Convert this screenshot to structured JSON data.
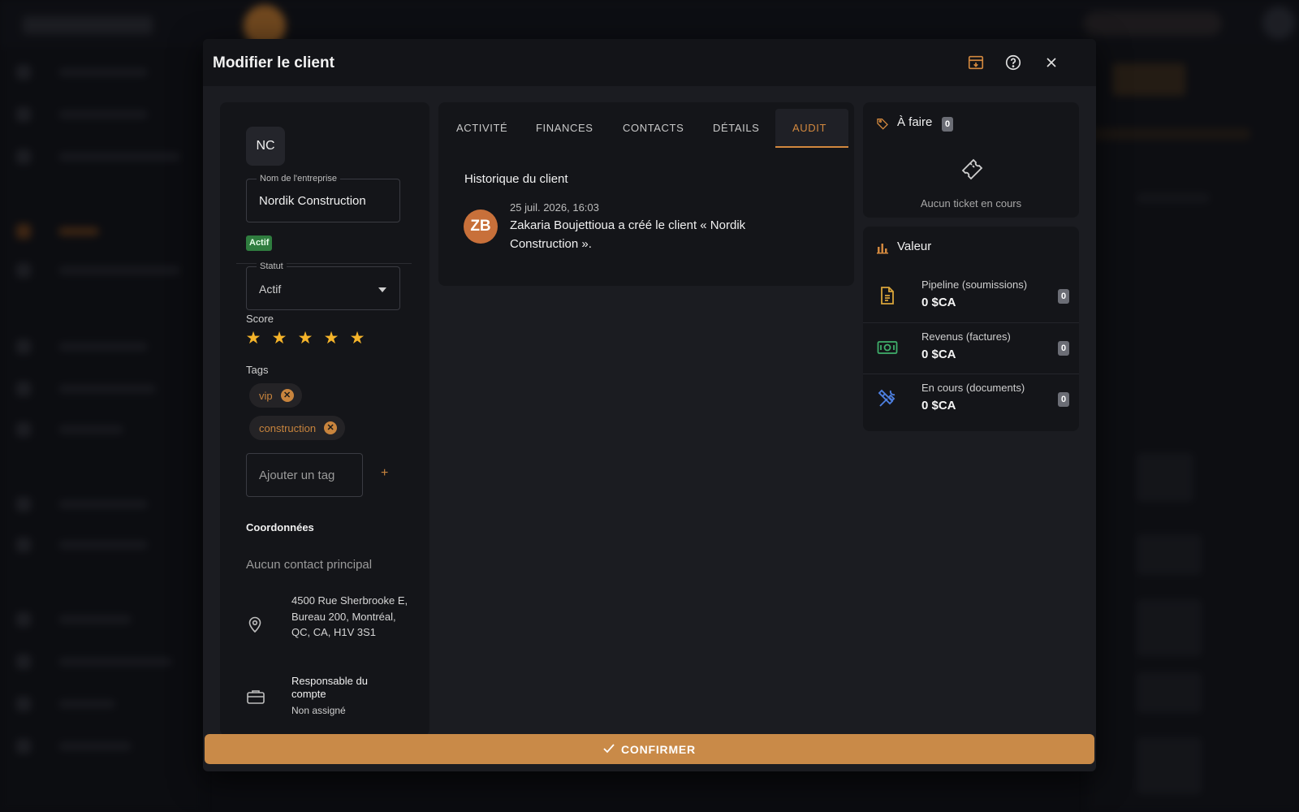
{
  "modal": {
    "title": "Modifier le client",
    "confirm_label": "CONFIRMER"
  },
  "client": {
    "initials": "NC",
    "company_label": "Nom de l'entreprise",
    "company_name": "Nordik Construction",
    "status_badge": "Actif",
    "status_label": "Statut",
    "status_value": "Actif",
    "score_label": "Score",
    "score": 5,
    "tags_label": "Tags",
    "tags": [
      "vip",
      "construction"
    ],
    "add_tag_placeholder": "Ajouter un tag",
    "add_tag_symbol": "+",
    "coords_title": "Coordonnées",
    "no_contact": "Aucun contact principal",
    "address": "4500 Rue Sherbrooke E, Bureau 200, Montréal, QC, CA, H1V 3S1",
    "account_manager_label": "Responsable du compte",
    "account_manager_value": "Non assigné"
  },
  "tabs": [
    {
      "label": "ACTIVITÉ",
      "active": false
    },
    {
      "label": "FINANCES",
      "active": false
    },
    {
      "label": "CONTACTS",
      "active": false
    },
    {
      "label": "DÉTAILS",
      "active": false
    },
    {
      "label": "AUDIT",
      "active": true
    }
  ],
  "history": {
    "title": "Historique du client",
    "entries": [
      {
        "avatar": "ZB",
        "date": "25 juil. 2026, 16:03",
        "text": "Zakaria Boujettioua a créé le client « Nordik Construction »."
      }
    ]
  },
  "todo": {
    "title": "À faire",
    "count": "0",
    "empty_text": "Aucun ticket en cours"
  },
  "value": {
    "title": "Valeur",
    "rows": [
      {
        "label": "Pipeline (soumissions)",
        "amount": "0 $CA",
        "count": "0",
        "icon": "document-icon",
        "color": "#d9a43a"
      },
      {
        "label": "Revenus (factures)",
        "amount": "0 $CA",
        "count": "0",
        "icon": "cash-icon",
        "color": "#3fae6a"
      },
      {
        "label": "En cours (documents)",
        "amount": "0 $CA",
        "count": "0",
        "icon": "tools-icon",
        "color": "#4d7fe0"
      }
    ]
  },
  "colors": {
    "accent": "#c98a48",
    "tab_active": "#d2883e",
    "star": "#f5b42a",
    "badge_green": "#2f7d3f"
  }
}
